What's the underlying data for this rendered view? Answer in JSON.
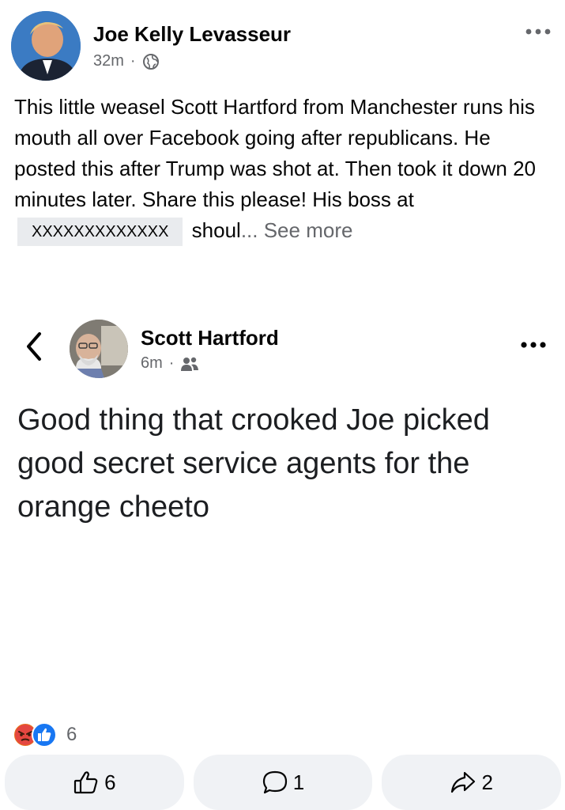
{
  "post": {
    "author": "Joe Kelly Levasseur",
    "time": "32m",
    "separator": "·",
    "text_before": "This little weasel Scott Hartford from Manchester runs his mouth all over Facebook going after republicans. He posted this after Trump was shot at. Then took it down 20 minutes later. Share this please! His boss at",
    "redacted": "XXXXXXXXXXXXX",
    "text_after": "shoul",
    "ellipsis": "...",
    "see_more": "See more"
  },
  "shared": {
    "author": "Scott Hartford",
    "time": "6m",
    "separator": "·",
    "text": "Good thing that crooked Joe picked good secret service agents for the orange cheeto"
  },
  "reactions": {
    "count": "6"
  },
  "actions": {
    "like_count": "6",
    "comment_count": "1",
    "share_count": "2"
  },
  "icons": {
    "privacy": "globe-icon",
    "audience": "friends-icon",
    "back": "chevron-left-icon",
    "more": "more-dots-icon"
  },
  "colors": {
    "angry": "#e9711c",
    "like": "#1877f2",
    "secondary_text": "#65676b",
    "button_bg": "#f0f2f5"
  }
}
